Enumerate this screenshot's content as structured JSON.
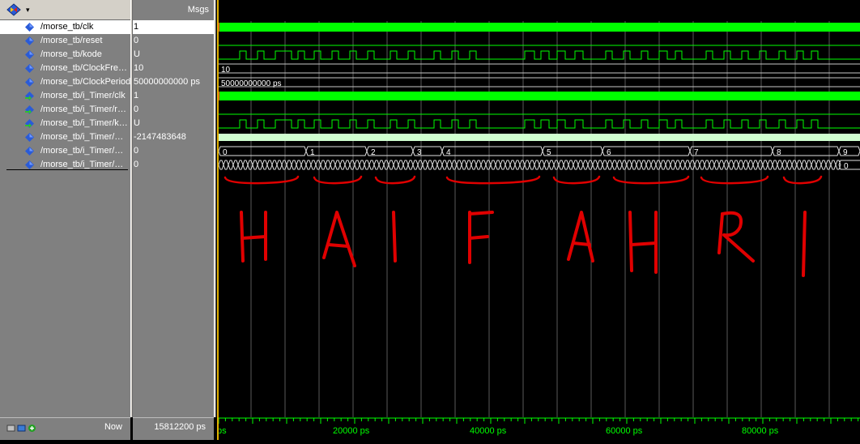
{
  "toolbar": {
    "icon": "wave-group-icon",
    "arrow": "▾"
  },
  "messages_header": "Msgs",
  "signals": [
    {
      "name": "/morse_tb/clk",
      "value": "1",
      "icon": "diamond-icon",
      "selected": true
    },
    {
      "name": "/morse_tb/reset",
      "value": "0",
      "icon": "diamond-icon"
    },
    {
      "name": "/morse_tb/kode",
      "value": "U",
      "icon": "diamond-icon"
    },
    {
      "name": "/morse_tb/ClockFre…",
      "value": "10",
      "icon": "diamond-icon"
    },
    {
      "name": "/morse_tb/ClockPeriod",
      "value": "50000000000 ps",
      "icon": "diamond-icon"
    },
    {
      "name": "/morse_tb/i_Timer/clk",
      "value": "1",
      "icon": "input-port-icon"
    },
    {
      "name": "/morse_tb/i_Timer/r…",
      "value": "0",
      "icon": "input-port-icon"
    },
    {
      "name": "/morse_tb/i_Timer/k…",
      "value": "U",
      "icon": "input-port-icon"
    },
    {
      "name": "/morse_tb/i_Timer/…",
      "value": "-2147483648",
      "icon": "diamond-icon"
    },
    {
      "name": "/morse_tb/i_Timer/…",
      "value": "0",
      "icon": "diamond-icon"
    },
    {
      "name": "/morse_tb/i_Timer/…",
      "value": "0",
      "icon": "diamond-icon"
    }
  ],
  "bus_values": {
    "clockfreq": "10",
    "clockperiod": "50000000000 ps",
    "counter": [
      "0",
      "1",
      "2",
      "3",
      "4",
      "5",
      "6",
      "7",
      "8",
      "9"
    ],
    "counter_end": "0"
  },
  "annotation_letters": [
    "H",
    "A",
    "I",
    "F",
    "A",
    "H",
    "R",
    "I"
  ],
  "status": {
    "now_label": "Now",
    "now_value": "15812200 ps"
  },
  "timeline": {
    "start_label": "ps",
    "labels": [
      "20000 ps",
      "40000 ps",
      "60000 ps",
      "80000 ps"
    ]
  },
  "colors": {
    "wave_green": "#00ff00",
    "selected_wave": "#00ff00",
    "annotation_red": "#e00000",
    "cursor_yellow": "#e0b000",
    "pane_gray": "#808080",
    "diamond_blue": "#2050d0"
  }
}
